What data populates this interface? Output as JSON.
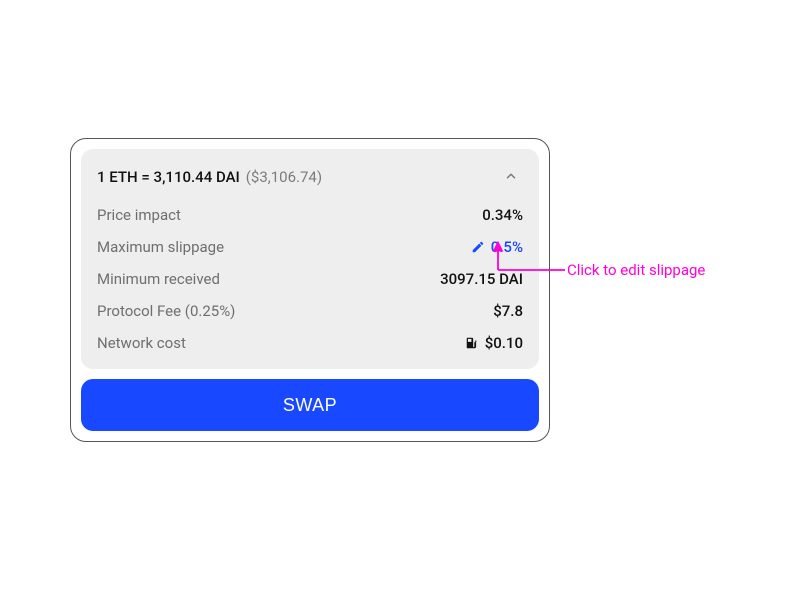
{
  "rate": {
    "text": "1 ETH = 3,110.44 DAI",
    "usd": "($3,106.74)"
  },
  "rows": {
    "price_impact": {
      "label": "Price impact",
      "value": "0.34%"
    },
    "max_slippage": {
      "label": "Maximum slippage",
      "value": "0.5%"
    },
    "min_received": {
      "label": "Minimum received",
      "value": "3097.15 DAI"
    },
    "protocol_fee": {
      "label": "Protocol Fee (0.25%)",
      "value": "$7.8"
    },
    "network_cost": {
      "label": "Network cost",
      "value": "$0.10"
    }
  },
  "swap_label": "SWAP",
  "annotation": {
    "text": "Click to edit slippage"
  },
  "icons": {
    "chevron_up": "chevron-up-icon",
    "pencil": "pencil-icon",
    "gas": "gas-pump-icon"
  }
}
